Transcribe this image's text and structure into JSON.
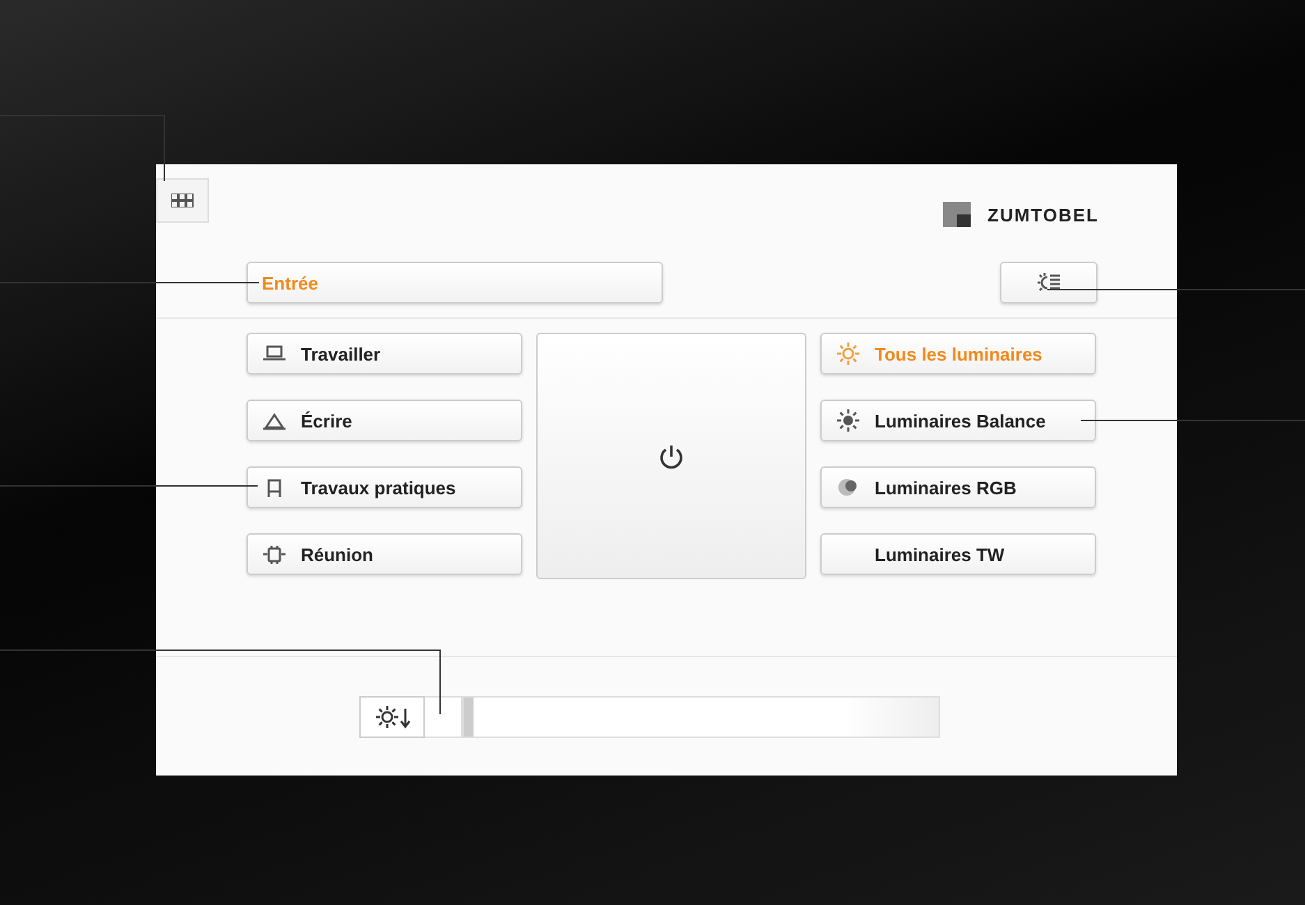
{
  "logo": {
    "name": "ZUMTOBEL"
  },
  "room": {
    "label": "Entrée",
    "selected": true
  },
  "scenes": [
    {
      "label": "Travailler",
      "selected": false
    },
    {
      "label": "Écrire",
      "selected": false
    },
    {
      "label": "Travaux pratiques",
      "selected": false
    },
    {
      "label": "Réunion",
      "selected": false
    }
  ],
  "groups": [
    {
      "label": "Tous les luminaires",
      "selected": true
    },
    {
      "label": "Luminaires Balance",
      "selected": false
    },
    {
      "label": "Luminaires RGB",
      "selected": false
    },
    {
      "label": "Luminaires TW",
      "selected": false
    }
  ],
  "dimmer": {
    "level": 0
  }
}
